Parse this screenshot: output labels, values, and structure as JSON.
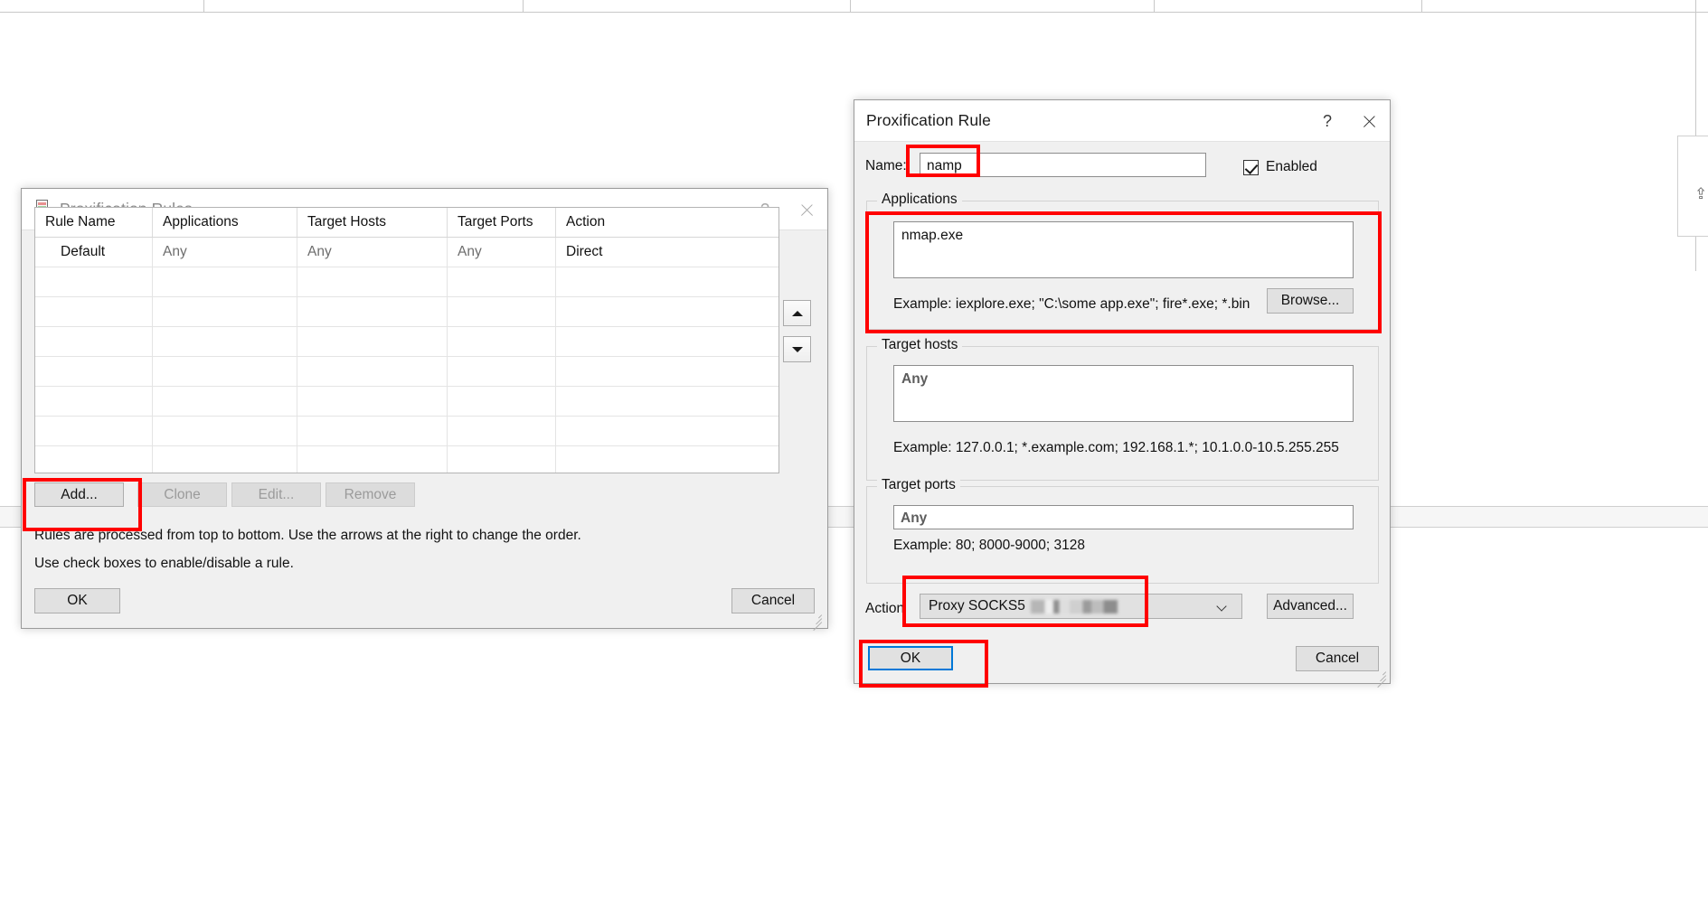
{
  "background": {
    "note": "partially visible application window behind the dialogs"
  },
  "rules_dialog": {
    "title": "Proxification Rules",
    "icon": "rules-document-icon",
    "help_label": "?",
    "close_label": "close-icon",
    "table": {
      "columns": [
        "Rule Name",
        "Applications",
        "Target Hosts",
        "Target Ports",
        "Action"
      ],
      "rows": [
        {
          "rule_name": "Default",
          "applications": "Any",
          "target_hosts": "Any",
          "target_ports": "Any",
          "action": "Direct"
        }
      ],
      "empty_row_count": 7
    },
    "order_controls": {
      "move_up": "move-up-arrow",
      "move_down": "move-down-arrow"
    },
    "buttons": {
      "add": "Add...",
      "clone": "Clone",
      "edit": "Edit...",
      "remove": "Remove",
      "ok": "OK",
      "cancel": "Cancel"
    },
    "hints": [
      "Rules are processed from top to bottom. Use the arrows at the right to change the order.",
      "Use check boxes to enable/disable a rule."
    ]
  },
  "rule_dialog": {
    "title": "Proxification Rule",
    "help_label": "?",
    "close_label": "close-icon",
    "name": {
      "label": "Name:",
      "value": "namp"
    },
    "enabled": {
      "label": "Enabled",
      "checked": true
    },
    "applications": {
      "legend": "Applications",
      "value": "nmap.exe",
      "example": "Example: iexplore.exe; \"C:\\some app.exe\"; fire*.exe; *.bin",
      "browse_label": "Browse..."
    },
    "target_hosts": {
      "legend": "Target hosts",
      "value": "Any",
      "is_placeholder": true,
      "example": "Example: 127.0.0.1; *.example.com; 192.168.1.*; 10.1.0.0-10.5.255.255"
    },
    "target_ports": {
      "legend": "Target ports",
      "value": "Any",
      "is_placeholder": true,
      "example": "Example: 80; 8000-9000; 3128"
    },
    "action": {
      "label": "Action",
      "value": "Proxy SOCKS5",
      "redacted_suffix": true,
      "advanced_label": "Advanced..."
    },
    "buttons": {
      "ok": "OK",
      "cancel": "Cancel"
    }
  },
  "annotations": {
    "color": "#ff0000",
    "boxes": [
      "add-button-highlight",
      "name-field-highlight",
      "applications-group-highlight",
      "action-combo-highlight",
      "rule-ok-button-highlight"
    ]
  }
}
